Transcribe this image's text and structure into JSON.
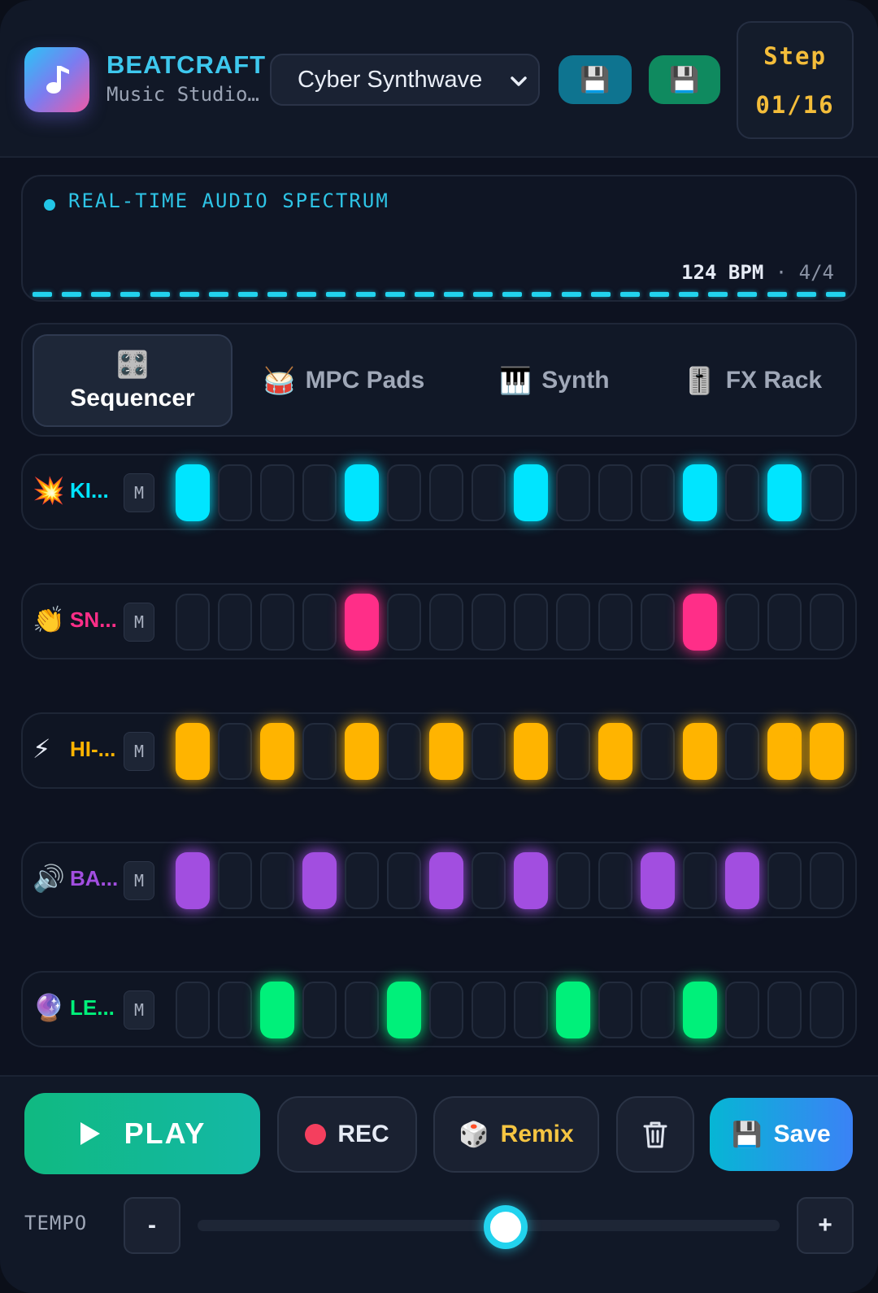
{
  "header": {
    "brand_name": "BEATCRAFT",
    "brand_sub": "Music Studio...",
    "logo_icon": "music-note-icon",
    "preset": "Cyber Synthwave",
    "icon_button_1": "💾",
    "icon_button_2": "💾",
    "step_label": "Step",
    "step_value": "01/16"
  },
  "spectrum": {
    "label": "REAL-TIME AUDIO SPECTRUM",
    "bpm": "124 BPM",
    "separator": "·",
    "time_sig": "4/4"
  },
  "tabs": [
    {
      "icon": "🎛️",
      "label": "Sequencer",
      "active": true
    },
    {
      "icon": "🥁",
      "label": "MPC Pads"
    },
    {
      "icon": "🎹",
      "label": "Synth"
    },
    {
      "icon": "🎚️",
      "label": "FX Rack"
    }
  ],
  "tracks": [
    {
      "icon": "💥",
      "name": "KI...",
      "mute": "M",
      "color": "#00e5ff",
      "steps": [
        1,
        0,
        0,
        0,
        1,
        0,
        0,
        0,
        1,
        0,
        0,
        0,
        1,
        0,
        1,
        0
      ]
    },
    {
      "icon": "👏",
      "name": "SN...",
      "mute": "M",
      "color": "#ff2e88",
      "steps": [
        0,
        0,
        0,
        0,
        1,
        0,
        0,
        0,
        0,
        0,
        0,
        0,
        1,
        0,
        0,
        0
      ]
    },
    {
      "icon": "⚡",
      "name": "HI-...",
      "mute": "M",
      "color": "#ffb400",
      "steps": [
        1,
        0,
        1,
        0,
        1,
        0,
        1,
        0,
        1,
        0,
        1,
        0,
        1,
        0,
        1,
        1
      ]
    },
    {
      "icon": "🔊",
      "name": "BA...",
      "mute": "M",
      "color": "#a24ee0",
      "steps": [
        1,
        0,
        0,
        1,
        0,
        0,
        1,
        0,
        1,
        0,
        0,
        1,
        0,
        1,
        0,
        0
      ]
    },
    {
      "icon": "🔮",
      "name": "LE...",
      "mute": "M",
      "color": "#00f07a",
      "steps": [
        0,
        0,
        1,
        0,
        0,
        1,
        0,
        0,
        0,
        1,
        0,
        0,
        1,
        0,
        0,
        0
      ]
    }
  ],
  "footer": {
    "play": "PLAY",
    "rec": "REC",
    "remix_icon": "🎲",
    "remix": "Remix",
    "save_icon": "💾",
    "save": "Save",
    "tempo_label": "TEMPO",
    "minus": "-",
    "plus": "+",
    "tempo_fraction": 0.53
  }
}
